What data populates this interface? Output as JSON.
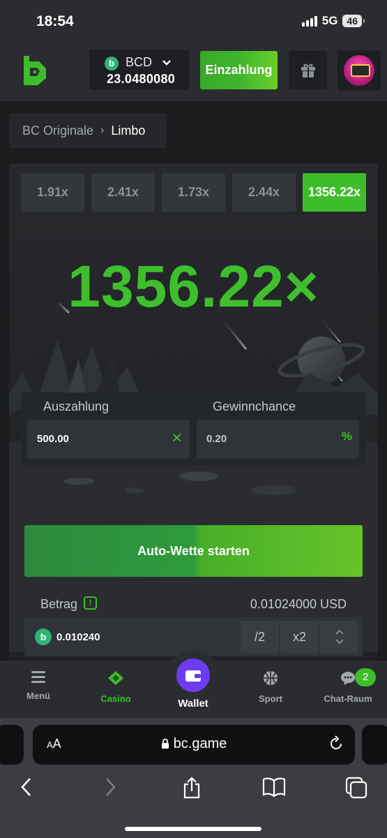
{
  "status_bar": {
    "time": "18:54",
    "network": "5G",
    "battery": "46"
  },
  "header": {
    "currency": "BCD",
    "currency_badge": "b",
    "balance": "23.0480080",
    "deposit_label": "Einzahlung"
  },
  "breadcrumb": {
    "parent": "BC Originale",
    "separator": "›",
    "current": "Limbo"
  },
  "game": {
    "history": [
      "1.91x",
      "2.41x",
      "1.73x",
      "2.44x",
      "1356.22x"
    ],
    "result": "1356.22×",
    "payout_label": "Auszahlung",
    "payout_value": "500.00",
    "payout_suffix": "✕",
    "chance_label": "Gewinnchance",
    "chance_value": "0.20",
    "chance_suffix": "%",
    "auto_bet_label": "Auto-Wette starten",
    "bet_label": "Betrag",
    "bet_info_icon": "!",
    "bet_usd": "0.01024000 USD",
    "bet_amount": "0.010240",
    "half_label": "/2",
    "double_label": "x2"
  },
  "nav": {
    "items": [
      {
        "label": "Menü",
        "icon": "menu-icon"
      },
      {
        "label": "Casino",
        "icon": "casino-icon"
      },
      {
        "label": "Wallet",
        "icon": "wallet-icon"
      },
      {
        "label": "Sport",
        "icon": "basketball-icon"
      },
      {
        "label": "Chat-Raum",
        "icon": "chat-icon"
      }
    ],
    "chat_badge": "2"
  },
  "browser": {
    "aa_small": "A",
    "aa_big": "A",
    "url": "bc.game"
  },
  "colors": {
    "accent": "#3ebd2b",
    "background": "#1a1c1e",
    "panel": "#2a2c2f",
    "wallet": "#6d3cf0"
  }
}
